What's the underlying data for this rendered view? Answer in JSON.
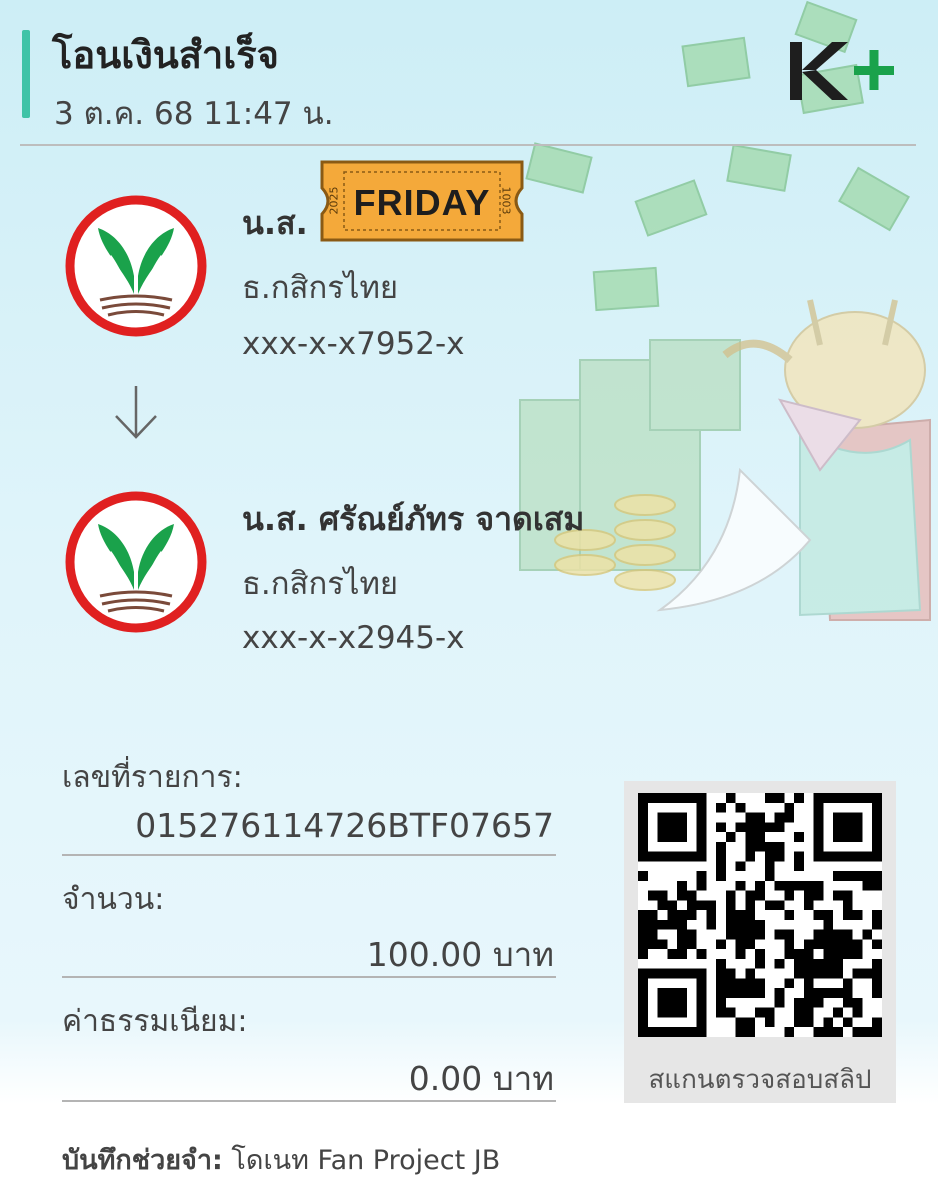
{
  "header": {
    "title": "โอนเงินสำเร็จ",
    "datetime": "3 ต.ค. 68  11:47 น.",
    "brand_logo_text": "K+"
  },
  "sticker": {
    "label": "FRIDAY",
    "left_small_text": "2025",
    "right_small_text": "1003"
  },
  "sender": {
    "name": "น.ส.",
    "bank": "ธ.กสิกรไทย",
    "account": "xxx-x-x7952-x",
    "logo_icon": "kbank-logo-icon"
  },
  "receiver": {
    "name": "น.ส. ศรัณย์ภัทร จาดเสม",
    "bank": "ธ.กสิกรไทย",
    "account": "xxx-x-x2945-x",
    "logo_icon": "kbank-logo-icon"
  },
  "transaction": {
    "ref_label": "เลขที่รายการ:",
    "ref_value": "015276114726BTF07657",
    "amount_label": "จำนวน:",
    "amount_value": "100.00 บาท",
    "fee_label": "ค่าธรรมเนียม:",
    "fee_value": "0.00 บาท"
  },
  "qr": {
    "caption": "สแกนตรวจสอบสลิป"
  },
  "memo": {
    "label": "บันทึกช่วยจำ:",
    "value": " โดเนท Fan Project JB"
  },
  "colors": {
    "accent": "#3fc3a7",
    "kbank_green": "#1aa24b",
    "kbank_red": "#e02020",
    "ticket_orange": "#f4a93a"
  }
}
